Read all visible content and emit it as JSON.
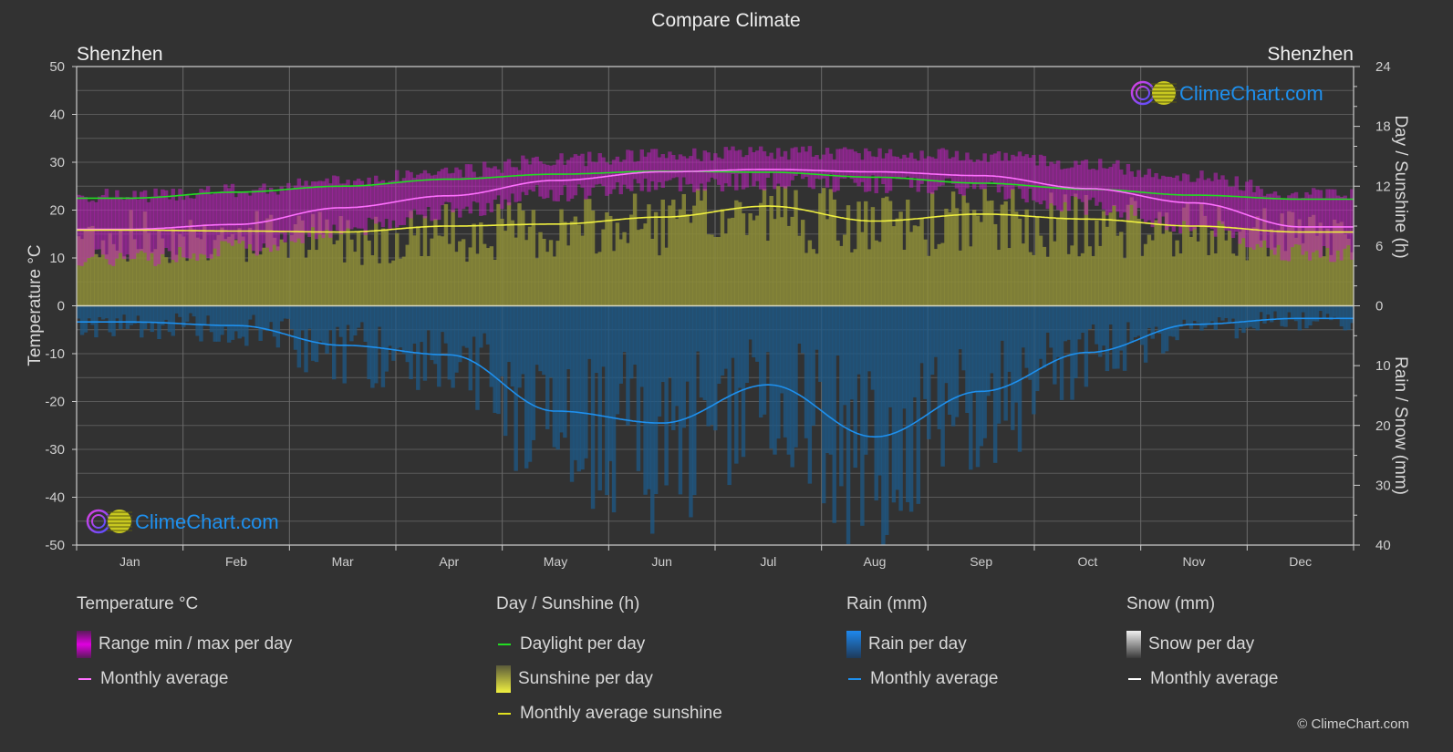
{
  "title": "Compare Climate",
  "location_left": "Shenzhen",
  "location_right": "Shenzhen",
  "logo_text": "ClimeChart.com",
  "copyright": "© ClimeChart.com",
  "colors": {
    "background": "#323232",
    "grid": "#5a5a5a",
    "temp_range": "#c020c0",
    "temp_avg": "#ff70ff",
    "daylight": "#22dd22",
    "sunshine_fill": "#8c8c38",
    "sunshine_avg": "#f0f040",
    "rain_fill": "#1e5a88",
    "rain_avg": "#1e90ee",
    "snow_avg": "#ffffff",
    "logo_text": "#1e90ee"
  },
  "legend": {
    "temperature": {
      "title": "Temperature °C",
      "items": [
        {
          "label": "Range min / max per day",
          "kind": "box",
          "color": "#e000e0"
        },
        {
          "label": "Monthly average",
          "kind": "line",
          "color": "#ff70ff"
        }
      ]
    },
    "sunshine": {
      "title": "Day / Sunshine (h)",
      "items": [
        {
          "label": "Daylight per day",
          "kind": "line",
          "color": "#22dd22"
        },
        {
          "label": "Sunshine per day",
          "kind": "box",
          "color": "#e8e830"
        },
        {
          "label": "Monthly average sunshine",
          "kind": "line",
          "color": "#e0e020"
        }
      ]
    },
    "rain": {
      "title": "Rain (mm)",
      "items": [
        {
          "label": "Rain per day",
          "kind": "box",
          "color": "#1e88e5"
        },
        {
          "label": "Monthly average",
          "kind": "line",
          "color": "#1e90ee"
        }
      ]
    },
    "snow": {
      "title": "Snow (mm)",
      "items": [
        {
          "label": "Snow per day",
          "kind": "box",
          "color": "#cccccc"
        },
        {
          "label": "Monthly average",
          "kind": "line",
          "color": "#ffffff"
        }
      ]
    }
  },
  "chart_data": {
    "type": "line",
    "title": "Compare Climate",
    "categories": [
      "Jan",
      "Feb",
      "Mar",
      "Apr",
      "May",
      "Jun",
      "Jul",
      "Aug",
      "Sep",
      "Oct",
      "Nov",
      "Dec"
    ],
    "axes": {
      "left": {
        "label": "Temperature °C",
        "range": [
          -50,
          50
        ],
        "ticks": [
          50,
          40,
          30,
          20,
          10,
          0,
          -10,
          -20,
          -30,
          -40,
          -50
        ]
      },
      "right_top": {
        "label": "Day / Sunshine (h)",
        "range": [
          0,
          24
        ],
        "ticks": [
          24,
          18,
          12,
          6,
          0
        ]
      },
      "right_bottom": {
        "label": "Rain / Snow (mm)",
        "range": [
          0,
          40
        ],
        "ticks": [
          0,
          10,
          20,
          30,
          40
        ],
        "inverted": true
      }
    },
    "grid": true,
    "series": [
      {
        "name": "Temperature monthly average (°C)",
        "axis": "left",
        "values": [
          16.0,
          17.0,
          20.5,
          23.0,
          26.2,
          28.0,
          28.5,
          28.0,
          27.2,
          24.5,
          21.5,
          16.5
        ]
      },
      {
        "name": "Temperature daily max envelope (°C)",
        "axis": "left",
        "values": [
          23,
          24,
          26,
          28,
          30.5,
          31.5,
          32,
          32,
          31.5,
          29.5,
          27,
          23.5
        ]
      },
      {
        "name": "Temperature daily min envelope (°C)",
        "axis": "left",
        "values": [
          10,
          12,
          16,
          20,
          23.5,
          25.5,
          26,
          25.5,
          24.5,
          21,
          16.5,
          11
        ]
      },
      {
        "name": "Daylight per day (h)",
        "axis": "right_top",
        "values": [
          10.8,
          11.4,
          12.0,
          12.7,
          13.2,
          13.5,
          13.4,
          12.9,
          12.3,
          11.7,
          11.1,
          10.7
        ]
      },
      {
        "name": "Monthly average sunshine (h)",
        "axis": "right_top",
        "values": [
          7.6,
          7.5,
          7.4,
          8.0,
          8.2,
          8.9,
          10.0,
          8.5,
          9.2,
          8.7,
          8.0,
          7.4
        ]
      },
      {
        "name": "Rain monthly average (mm)",
        "axis": "right_bottom",
        "values": [
          2.7,
          3.3,
          6.6,
          8.2,
          17.6,
          19.6,
          13.2,
          21.9,
          14.3,
          7.8,
          3.1,
          2.1
        ]
      },
      {
        "name": "Snow monthly average (mm)",
        "axis": "right_bottom",
        "values": [
          0,
          0,
          0,
          0,
          0,
          0,
          0,
          0,
          0,
          0,
          0,
          0
        ]
      }
    ]
  }
}
